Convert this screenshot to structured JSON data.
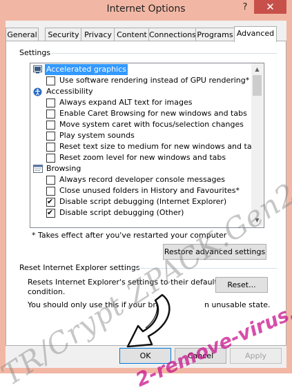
{
  "window": {
    "title": "Internet Options",
    "help_glyph": "?",
    "close_glyph": "✕"
  },
  "tabs": [
    {
      "label": "General"
    },
    {
      "label": "Security"
    },
    {
      "label": "Privacy"
    },
    {
      "label": "Content"
    },
    {
      "label": "Connections"
    },
    {
      "label": "Programs"
    },
    {
      "label": "Advanced",
      "active": true
    }
  ],
  "settings": {
    "group_label": "Settings",
    "items": [
      {
        "type": "category",
        "icon": "monitor-icon",
        "label": "Accelerated graphics",
        "selected": true
      },
      {
        "type": "checkbox",
        "checked": false,
        "label": "Use software rendering instead of GPU rendering*"
      },
      {
        "type": "category",
        "icon": "accessibility-icon",
        "label": "Accessibility"
      },
      {
        "type": "checkbox",
        "checked": false,
        "label": "Always expand ALT text for images"
      },
      {
        "type": "checkbox",
        "checked": false,
        "label": "Enable Caret Browsing for new windows and tabs"
      },
      {
        "type": "checkbox",
        "checked": false,
        "label": "Move system caret with focus/selection changes"
      },
      {
        "type": "checkbox",
        "checked": false,
        "label": "Play system sounds"
      },
      {
        "type": "checkbox",
        "checked": false,
        "label": "Reset text size to medium for new windows and tabs"
      },
      {
        "type": "checkbox",
        "checked": false,
        "label": "Reset zoom level for new windows and tabs"
      },
      {
        "type": "category",
        "icon": "browsing-icon",
        "label": "Browsing"
      },
      {
        "type": "checkbox",
        "checked": false,
        "label": "Always record developer console messages"
      },
      {
        "type": "checkbox",
        "checked": false,
        "label": "Close unused folders in History and Favourites*"
      },
      {
        "type": "checkbox",
        "checked": true,
        "label": "Disable script debugging (Internet Explorer)"
      },
      {
        "type": "checkbox",
        "checked": true,
        "label": "Disable script debugging (Other)"
      }
    ],
    "footnote": "* Takes effect after you've restarted your computer",
    "restore_button": "Restore advanced settings"
  },
  "reset": {
    "group_label": "Reset Internet Explorer settings",
    "description_line1": "Resets Internet Explorer's settings to their default",
    "description_line2": "condition.",
    "warning": "You should only use this if your brow",
    "warning_tail": "n unusable state.",
    "reset_button": "Reset..."
  },
  "footer": {
    "ok": "OK",
    "cancel": "Cancel",
    "apply": "Apply"
  },
  "watermarks": {
    "left": "TR/Crypt.ZPACK.Gen2",
    "right": "2-remove-virus.com"
  }
}
